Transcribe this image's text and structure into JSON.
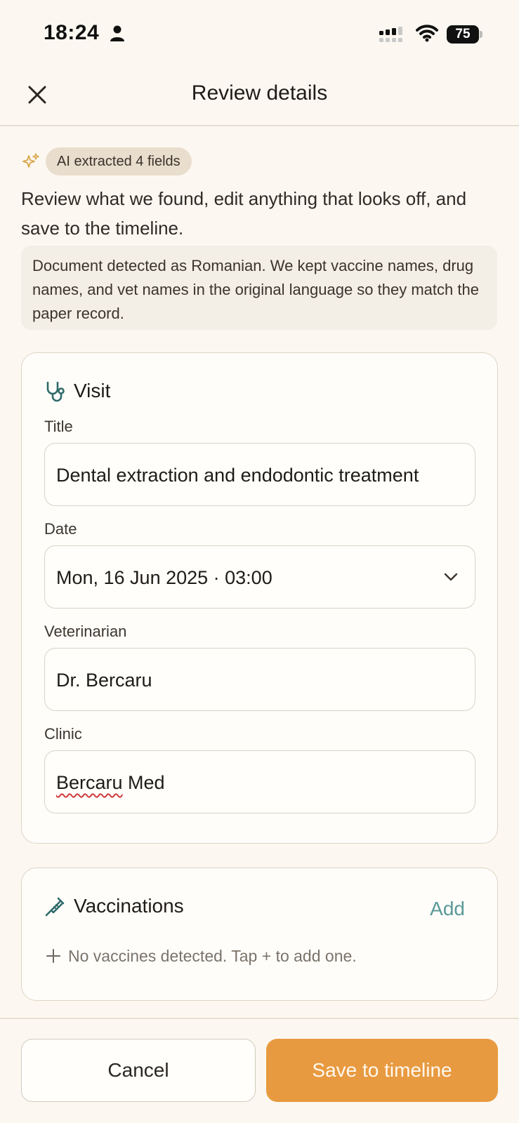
{
  "status_bar": {
    "time": "18:24",
    "battery": "75"
  },
  "header": {
    "title": "Review details"
  },
  "ai": {
    "badge": "AI extracted 4 fields"
  },
  "intro": "Review what we found, edit anything that looks off, and save to the timeline.",
  "notice": "Document detected as Romanian. We kept vaccine names, drug names, and vet names in the original language so they match the paper record.",
  "visit": {
    "title": "Visit",
    "fields": {
      "title_label": "Title",
      "title_value": "Dental extraction and endodontic treatment",
      "date_label": "Date",
      "date_value": "Mon, 16 Jun 2025 · 03:00",
      "vet_label": "Veterinarian",
      "vet_value": "Dr. Bercaru",
      "clinic_label": "Clinic",
      "clinic_value_word1": "Bercaru",
      "clinic_value_word2": " Med"
    }
  },
  "vaccinations": {
    "title": "Vaccinations",
    "add_label": "Add",
    "empty_text": "No vaccines detected. Tap + to add one."
  },
  "footer": {
    "cancel_label": "Cancel",
    "save_label": "Save to timeline"
  },
  "colors": {
    "accent": "#e89a40",
    "link": "#5a9a98",
    "icon_teal": "#2f6b6a",
    "background": "#fcf8f1"
  }
}
